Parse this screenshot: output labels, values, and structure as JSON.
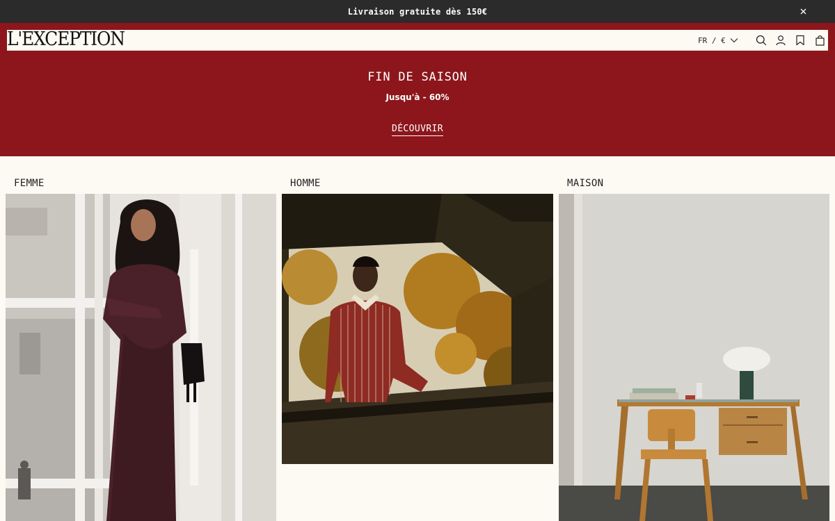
{
  "announcement": {
    "text": "Livraison gratuite dès 150€",
    "close_icon": "close-icon"
  },
  "header": {
    "logo_text": "L'EXCEPTION",
    "locale": "FR / €",
    "icons": [
      "search-icon",
      "account-icon",
      "wishlist-icon",
      "cart-icon"
    ]
  },
  "promo": {
    "title": "FIN DE SAISON",
    "subtitle": "Jusqu'à - 60%",
    "cta": "DÉCOUVRIR"
  },
  "categories": [
    {
      "label": "FEMME"
    },
    {
      "label": "HOMME"
    },
    {
      "label": "MAISON"
    }
  ],
  "colors": {
    "announcement_bg": "#2b2b2b",
    "promo_bg": "#8c161b",
    "page_bg": "#fdf9f3"
  }
}
